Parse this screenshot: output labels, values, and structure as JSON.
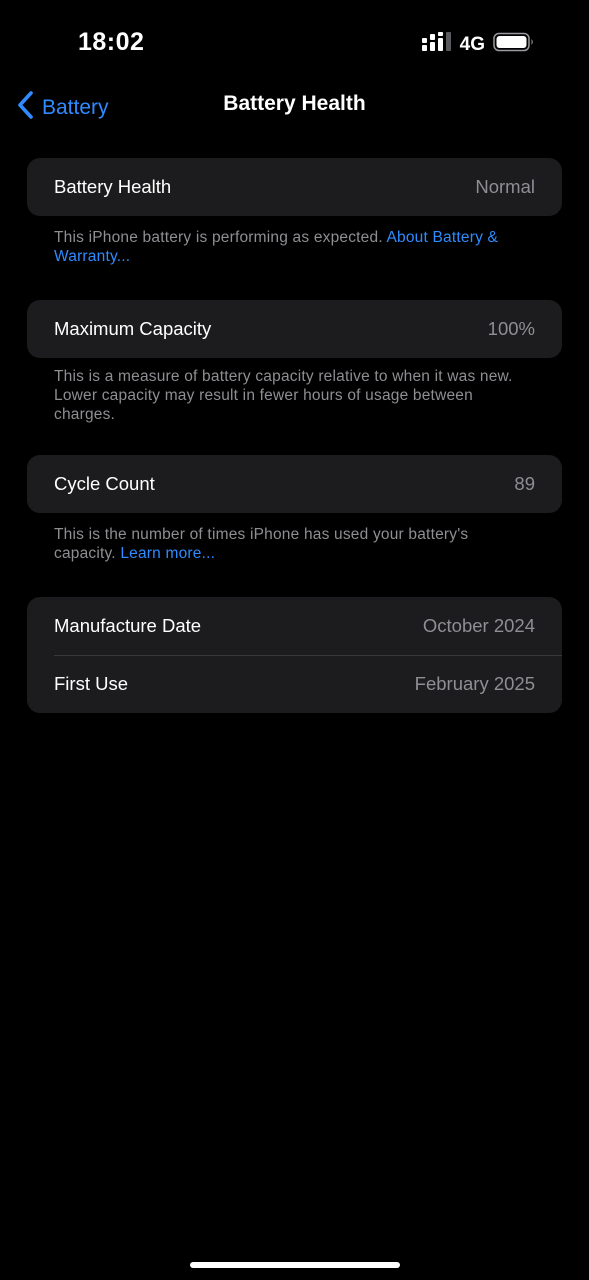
{
  "status_bar": {
    "time": "18:02",
    "network": "4G",
    "icons": [
      "cellular-signal-icon",
      "battery-icon"
    ]
  },
  "nav": {
    "back_label": "Battery",
    "title": "Battery Health",
    "icons": [
      "chevron-left-icon"
    ]
  },
  "battery_health": {
    "label": "Battery Health",
    "value": "Normal",
    "note": "This iPhone battery is performing as expected.",
    "link": "About Battery & Warranty..."
  },
  "max_capacity": {
    "label": "Maximum Capacity",
    "value": "100%",
    "note": "This is a measure of battery capacity relative to when it was new. Lower capacity may result in fewer hours of usage between charges."
  },
  "cycle_count": {
    "label": "Cycle Count",
    "value": "89",
    "note": "This is the number of times iPhone has used your battery's capacity.",
    "link": "Learn more..."
  },
  "dates": {
    "manufacture_label": "Manufacture Date",
    "manufacture_value": "October 2024",
    "first_use_label": "First Use",
    "first_use_value": "February 2025"
  },
  "colors": {
    "accent": "#2f8bff",
    "background": "#000000",
    "card": "#1c1c1e",
    "secondary_text": "#8e8e93"
  }
}
